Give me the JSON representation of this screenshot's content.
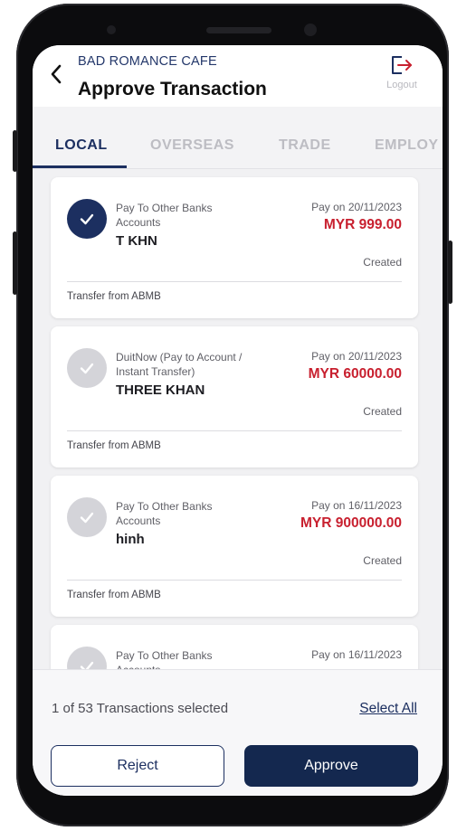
{
  "header": {
    "company": "BAD ROMANCE CAFE",
    "title": "Approve Transaction",
    "logout_label": "Logout"
  },
  "tabs": [
    {
      "label": "LOCAL",
      "active": true
    },
    {
      "label": "OVERSEAS",
      "active": false
    },
    {
      "label": "TRADE",
      "active": false
    },
    {
      "label": "EMPLOY",
      "active": false
    }
  ],
  "transactions": [
    {
      "type": "Pay To Other Banks Accounts",
      "payee": "T KHN",
      "pay_on": "Pay on 20/11/2023",
      "amount": "MYR 999.00",
      "status": "Created",
      "from": "Transfer from ABMB",
      "selected": true
    },
    {
      "type": "DuitNow (Pay to Account / Instant Transfer)",
      "payee": "THREE KHAN",
      "pay_on": "Pay on 20/11/2023",
      "amount": "MYR 60000.00",
      "status": "Created",
      "from": "Transfer from ABMB",
      "selected": false
    },
    {
      "type": "Pay To Other Banks Accounts",
      "payee": "hinh",
      "pay_on": "Pay on 16/11/2023",
      "amount": "MYR 900000.00",
      "status": "Created",
      "from": "Transfer from ABMB",
      "selected": false
    },
    {
      "type": "Pay To Other Banks Accounts",
      "payee": "",
      "pay_on": "Pay on 16/11/2023",
      "amount": "",
      "status": "",
      "from": "",
      "selected": false
    }
  ],
  "footer": {
    "selection_summary": "1 of 53 Transactions selected",
    "select_all": "Select All",
    "reject": "Reject",
    "approve": "Approve"
  },
  "colors": {
    "primary": "#1c2f60",
    "amount_red": "#c8202f"
  },
  "icons": {
    "back": "chevron-left-icon",
    "logout": "logout-icon",
    "checked": "check-icon"
  }
}
